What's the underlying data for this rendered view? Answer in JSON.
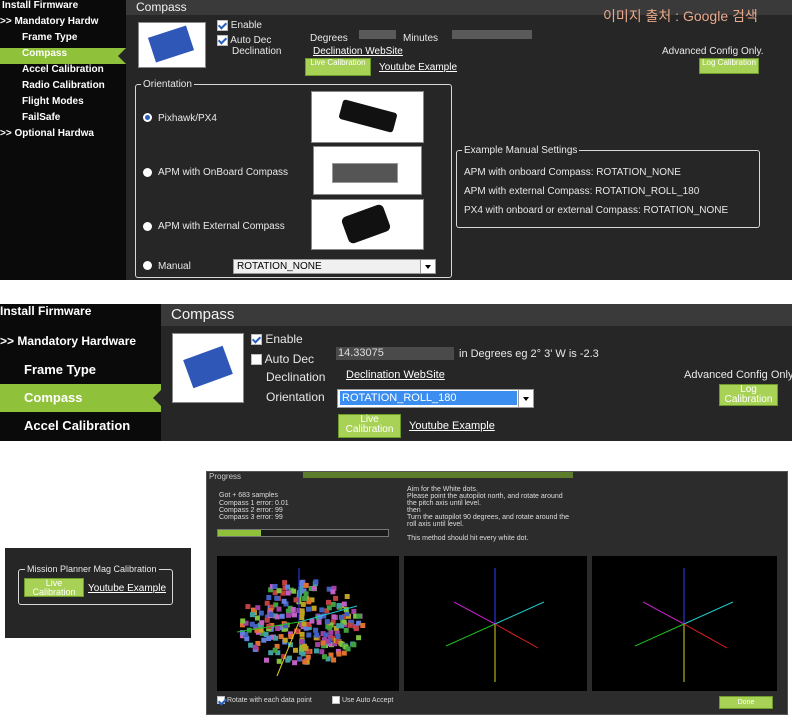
{
  "watermark": "이미지 출처 : Google 검색",
  "panel1": {
    "sidebar": [
      {
        "label": "Install Firmware"
      },
      {
        "label": ">> Mandatory Hardw"
      },
      {
        "label": "Frame Type"
      },
      {
        "label": "Compass"
      },
      {
        "label": "Accel Calibration"
      },
      {
        "label": "Radio Calibration"
      },
      {
        "label": "Flight Modes"
      },
      {
        "label": "FailSafe"
      },
      {
        "label": ">> Optional Hardwa"
      }
    ],
    "title": "Compass",
    "enable_label": "Enable",
    "autodec_label": "Auto Dec",
    "declination_label": "Declination",
    "degrees_label": "Degrees",
    "minutes_label": "Minutes",
    "declination_link": "Declination WebSite",
    "live_calibration": "Live Calibration",
    "youtube_link": "Youtube Example",
    "advanced_label": "Advanced Config Only.",
    "log_calibration": "Log Calibration",
    "orientation_title": "Orientation",
    "options": [
      {
        "label": "Pixhawk/PX4"
      },
      {
        "label": "APM with OnBoard Compass"
      },
      {
        "label": "APM with External Compass"
      },
      {
        "label": "Manual"
      }
    ],
    "manual_value": "ROTATION_NONE",
    "example_title": "Example Manual Settings",
    "examples": [
      "APM with onboard Compass: ROTATION_NONE",
      "APM with external Compass: ROTATION_ROLL_180",
      "PX4 with onboard or external Compass: ROTATION_NONE"
    ]
  },
  "panel2": {
    "sidebar": [
      {
        "label": "Install Firmware"
      },
      {
        "label": ">> Mandatory Hardware"
      },
      {
        "label": "Frame Type"
      },
      {
        "label": "Compass"
      },
      {
        "label": "Accel Calibration"
      }
    ],
    "title": "Compass",
    "enable_label": "Enable",
    "autodec_label": "Auto Dec",
    "declination_label": "Declination",
    "declination_value": "14.33075",
    "declination_hint": "in Degrees eg 2° 3' W is -2.3",
    "declination_link": "Declination WebSite",
    "orientation_label": "Orientation",
    "orientation_value": "ROTATION_ROLL_180",
    "advanced_label": "Advanced Config Only.",
    "log_calibration": "Log Calibration",
    "live_calibration": "Live Calibration",
    "youtube_link": "Youtube Example"
  },
  "panel3": {
    "group_title": "Mission Planner Mag Calibration",
    "live_calibration": "Live Calibration",
    "youtube_link": "Youtube Example"
  },
  "progress": {
    "title": "Progress",
    "samples_line": "Got + 683 samples",
    "errors": [
      "Compass 1 error: 0.01",
      "Compass 2 error: 99",
      "Compass 3 error: 99"
    ],
    "instructions": [
      "Aim for the White dots.",
      "Please point the autopilot north, and rotate around",
      "the pitch axis until level.",
      "then",
      "Turn the autopilot 90 degrees, and rotate around the",
      "roll axis until level.",
      "",
      "This method should hit every white dot."
    ],
    "rotate_label": "Rotate with each data point",
    "auto_accept_label": "Use Auto Accept",
    "done_label": "Done",
    "progress_fraction": 0.25
  }
}
